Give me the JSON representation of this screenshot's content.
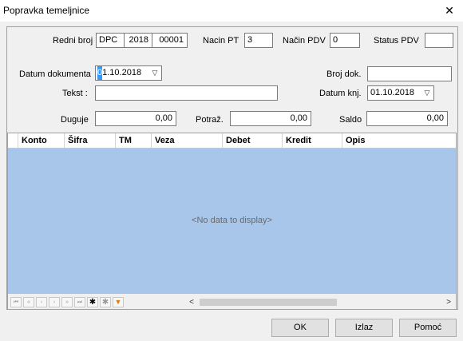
{
  "window": {
    "title": "Popravka temeljnice",
    "close_glyph": "✕"
  },
  "form": {
    "redni_broj": {
      "label": "Redni broj",
      "prefix": "DPC",
      "year": "2018",
      "number": "00001"
    },
    "nacin_pt": {
      "label": "Nacin PT",
      "value": "3"
    },
    "nacin_pdv": {
      "label": "Način PDV",
      "value": "0"
    },
    "status_pdv": {
      "label": "Status PDV",
      "value": ""
    },
    "datum_dokumenta": {
      "label": "Datum dokumenta",
      "first_char": "0",
      "rest": "1.10.2018"
    },
    "broj_dok": {
      "label": "Broj dok.",
      "value": ""
    },
    "tekst": {
      "label": "Tekst :",
      "value": ""
    },
    "datum_knj": {
      "label": "Datum knj.",
      "value": "01.10.2018"
    },
    "duguje": {
      "label": "Duguje",
      "value": "0,00"
    },
    "potraz": {
      "label": "Potraž.",
      "value": "0,00"
    },
    "saldo": {
      "label": "Saldo",
      "value": "0,00"
    }
  },
  "grid": {
    "columns": [
      "Konto",
      "Šifra",
      "TM",
      "Veza",
      "Debet",
      "Kredit",
      "Opis"
    ],
    "empty_text": "<No data to display>",
    "nav_glyphs": [
      "⏮",
      "«",
      "‹",
      "›",
      "»",
      "⏭",
      "✱",
      "✱",
      "▼"
    ],
    "scroll_left": "<",
    "scroll_right": ">"
  },
  "buttons": {
    "ok": "OK",
    "izlaz": "Izlaz",
    "pomoc": "Pomoć"
  },
  "icons": {
    "close": "close-icon",
    "dropdown": "chevron-down-icon",
    "filter": "filter-icon",
    "insert": "asterisk-icon"
  },
  "colors": {
    "grid_body": "#a8c6ea",
    "selection": "#3399ff",
    "filter": "#e07a1a"
  }
}
